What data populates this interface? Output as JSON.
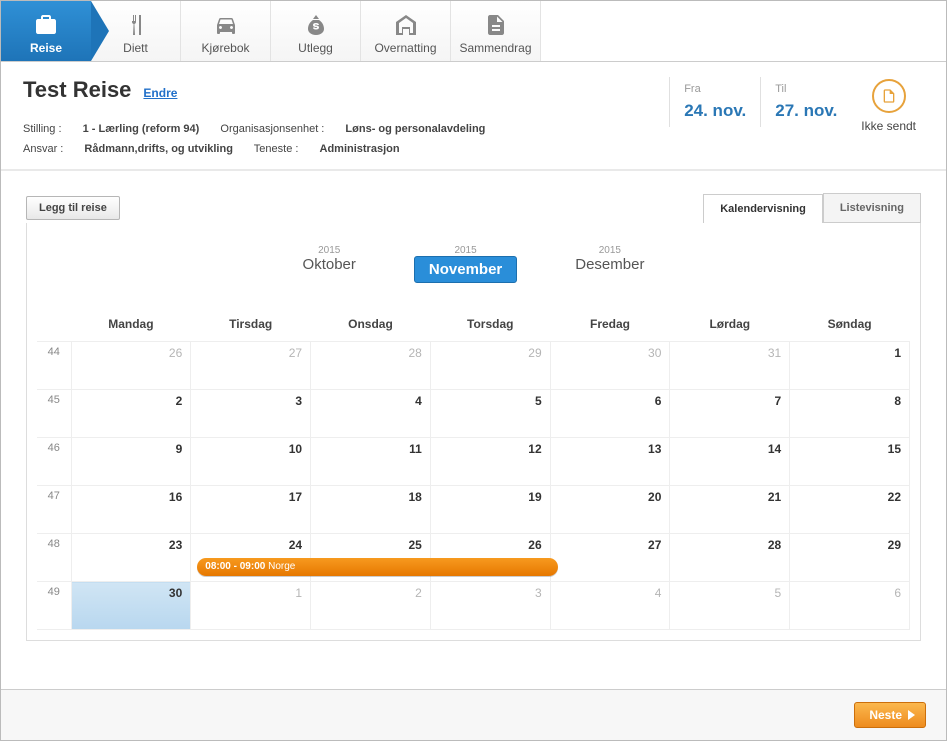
{
  "nav": {
    "tabs": [
      {
        "label": "Reise",
        "icon": "suitcase"
      },
      {
        "label": "Diett",
        "icon": "plate"
      },
      {
        "label": "Kjørebok",
        "icon": "car"
      },
      {
        "label": "Utlegg",
        "icon": "moneybag"
      },
      {
        "label": "Overnatting",
        "icon": "hotel"
      },
      {
        "label": "Sammendrag",
        "icon": "doc"
      }
    ],
    "active": 0
  },
  "header": {
    "title": "Test Reise",
    "edit": "Endre",
    "meta": {
      "stilling_label": "Stilling :",
      "stilling": "1 - Lærling (reform 94)",
      "org_label": "Organisasjonsenhet :",
      "org": "Løns- og personalavdeling",
      "ansvar_label": "Ansvar :",
      "ansvar": "Rådmann,drifts, og utvikling",
      "teneste_label": "Teneste :",
      "teneste": "Administrasjon"
    },
    "from_label": "Fra",
    "from_date": "24. nov.",
    "to_label": "Til",
    "to_date": "27. nov.",
    "status": "Ikke sendt"
  },
  "toolbar": {
    "add_trip": "Legg til reise",
    "view_cal": "Kalendervisning",
    "view_list": "Listevisning"
  },
  "months": [
    {
      "year": "2015",
      "name": "Oktober"
    },
    {
      "year": "2015",
      "name": "November"
    },
    {
      "year": "2015",
      "name": "Desember"
    }
  ],
  "months_active": 1,
  "days": [
    "Mandag",
    "Tirsdag",
    "Onsdag",
    "Torsdag",
    "Fredag",
    "Lørdag",
    "Søndag"
  ],
  "weeks": [
    {
      "num": "44",
      "d": [
        {
          "n": "26",
          "o": true
        },
        {
          "n": "27",
          "o": true
        },
        {
          "n": "28",
          "o": true
        },
        {
          "n": "29",
          "o": true
        },
        {
          "n": "30",
          "o": true
        },
        {
          "n": "31",
          "o": true
        },
        {
          "n": "1"
        }
      ]
    },
    {
      "num": "45",
      "d": [
        {
          "n": "2"
        },
        {
          "n": "3"
        },
        {
          "n": "4"
        },
        {
          "n": "5"
        },
        {
          "n": "6"
        },
        {
          "n": "7"
        },
        {
          "n": "8"
        }
      ]
    },
    {
      "num": "46",
      "d": [
        {
          "n": "9"
        },
        {
          "n": "10"
        },
        {
          "n": "11"
        },
        {
          "n": "12"
        },
        {
          "n": "13"
        },
        {
          "n": "14"
        },
        {
          "n": "15"
        }
      ]
    },
    {
      "num": "47",
      "d": [
        {
          "n": "16"
        },
        {
          "n": "17"
        },
        {
          "n": "18"
        },
        {
          "n": "19"
        },
        {
          "n": "20"
        },
        {
          "n": "21"
        },
        {
          "n": "22"
        }
      ]
    },
    {
      "num": "48",
      "d": [
        {
          "n": "23"
        },
        {
          "n": "24",
          "e": true
        },
        {
          "n": "25"
        },
        {
          "n": "26"
        },
        {
          "n": "27"
        },
        {
          "n": "28"
        },
        {
          "n": "29"
        }
      ]
    },
    {
      "num": "49",
      "d": [
        {
          "n": "30",
          "today": true
        },
        {
          "n": "1",
          "o": true
        },
        {
          "n": "2",
          "o": true
        },
        {
          "n": "3",
          "o": true
        },
        {
          "n": "4",
          "o": true
        },
        {
          "n": "5",
          "o": true
        },
        {
          "n": "6",
          "o": true
        }
      ]
    }
  ],
  "event": {
    "time": "08:00 - 09:00",
    "text": "Norge",
    "span_days": 3
  },
  "footer": {
    "next": "Neste"
  }
}
